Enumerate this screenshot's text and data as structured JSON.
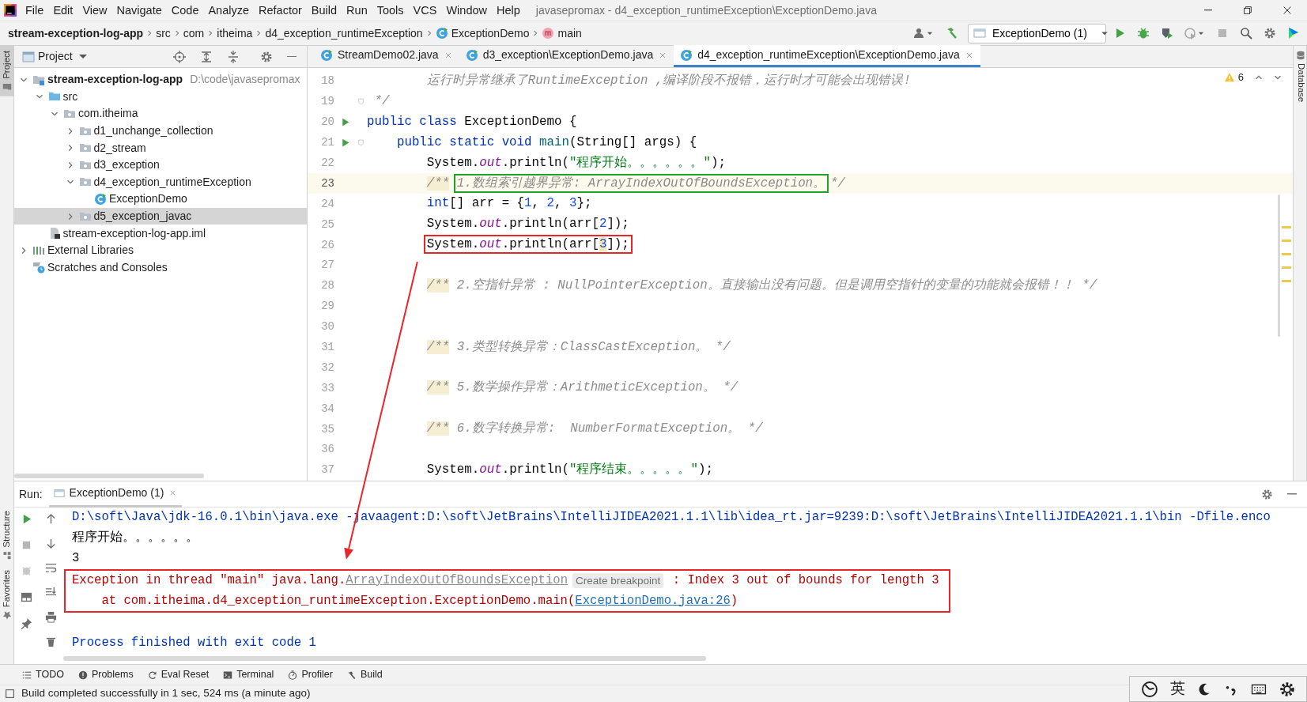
{
  "window": {
    "title": "javasepromax - d4_exception_runtimeException\\ExceptionDemo.java"
  },
  "menu": [
    "File",
    "Edit",
    "View",
    "Navigate",
    "Code",
    "Analyze",
    "Refactor",
    "Build",
    "Run",
    "Tools",
    "VCS",
    "Window",
    "Help"
  ],
  "breadcrumbs": [
    {
      "label": "stream-exception-log-app",
      "kind": "project"
    },
    {
      "label": "src",
      "kind": "dir"
    },
    {
      "label": "com",
      "kind": "dir"
    },
    {
      "label": "itheima",
      "kind": "dir"
    },
    {
      "label": "d4_exception_runtimeException",
      "kind": "dir"
    },
    {
      "label": "ExceptionDemo",
      "kind": "class"
    },
    {
      "label": "main",
      "kind": "method"
    }
  ],
  "run_config": {
    "label": "ExceptionDemo (1)"
  },
  "left_strip": {
    "top": [
      {
        "label": "Project",
        "selected": true
      }
    ],
    "bottom": [
      {
        "label": "Structure",
        "selected": false
      },
      {
        "label": "Favorites",
        "selected": false
      }
    ]
  },
  "right_strip": [
    {
      "label": "Database"
    }
  ],
  "project_panel": {
    "title": "Project",
    "tree": [
      {
        "label": "stream-exception-log-app",
        "path": "D:\\code\\javasepromax",
        "kind": "module",
        "expanded": true,
        "selected": false,
        "children": [
          {
            "label": "src",
            "kind": "src",
            "expanded": true,
            "selected": false,
            "children": [
              {
                "label": "com.itheima",
                "kind": "package",
                "expanded": true,
                "selected": false,
                "children": [
                  {
                    "label": "d1_unchange_collection",
                    "kind": "package",
                    "expanded": false,
                    "selected": false
                  },
                  {
                    "label": "d2_stream",
                    "kind": "package",
                    "expanded": false,
                    "selected": false
                  },
                  {
                    "label": "d3_exception",
                    "kind": "package",
                    "expanded": false,
                    "selected": false
                  },
                  {
                    "label": "d4_exception_runtimeException",
                    "kind": "package",
                    "expanded": true,
                    "selected": false,
                    "children": [
                      {
                        "label": "ExceptionDemo",
                        "kind": "class",
                        "selected": false
                      }
                    ]
                  },
                  {
                    "label": "d5_exception_javac",
                    "kind": "package",
                    "expanded": false,
                    "selected": true
                  }
                ]
              }
            ]
          },
          {
            "label": "stream-exception-log-app.iml",
            "kind": "iml",
            "selected": false
          }
        ]
      },
      {
        "label": "External Libraries",
        "kind": "library",
        "expanded": false,
        "selected": false
      },
      {
        "label": "Scratches and Consoles",
        "kind": "scratch",
        "selected": false
      }
    ]
  },
  "editor": {
    "tabs": [
      {
        "label": "StreamDemo02.java",
        "selected": false
      },
      {
        "label": "d3_exception\\ExceptionDemo.java",
        "selected": false
      },
      {
        "label": "d4_exception_runtimeException\\ExceptionDemo.java",
        "selected": true
      }
    ],
    "warnings": "6",
    "lines": [
      {
        "n": "18",
        "segs": [
          {
            "kind": "comment",
            "t": "        运行时异常继承了RuntimeException ,编译阶段不报错，运行时才可能会出现错误!"
          }
        ]
      },
      {
        "n": "19",
        "fold": true,
        "segs": [
          {
            "kind": "comment",
            "t": " */"
          }
        ]
      },
      {
        "n": "20",
        "run": true,
        "segs": [
          {
            "kind": "kw",
            "t": "public class "
          },
          {
            "kind": "plain",
            "t": "ExceptionDemo {"
          }
        ]
      },
      {
        "n": "21",
        "run": true,
        "fold": true,
        "segs": [
          {
            "kind": "kw",
            "t": "    public static void "
          },
          {
            "kind": "decl",
            "t": "main"
          },
          {
            "kind": "plain",
            "t": "(String[] args) {"
          }
        ]
      },
      {
        "n": "22",
        "segs": [
          {
            "kind": "plain",
            "t": "        System."
          },
          {
            "kind": "field",
            "t": "out"
          },
          {
            "kind": "plain",
            "t": ".println("
          },
          {
            "kind": "str",
            "t": "\"程序开始。。。。。。\""
          },
          {
            "kind": "plain",
            "t": ");"
          }
        ]
      },
      {
        "n": "23",
        "current": true,
        "segs": [
          {
            "kind": "doc",
            "t": "        /**"
          },
          {
            "kind": "box",
            "color": "#1fa22e",
            "segs": [
              {
                "kind": "comment",
                "t": " 1.数组索引越界异常: ArrayIndexOutOfBoundsException。"
              }
            ]
          },
          {
            "kind": "comment",
            "t": "*/"
          }
        ]
      },
      {
        "n": "24",
        "segs": [
          {
            "kind": "kw",
            "t": "        int"
          },
          {
            "kind": "plain",
            "t": "[] arr = {"
          },
          {
            "kind": "num",
            "t": "1"
          },
          {
            "kind": "plain",
            "t": ", "
          },
          {
            "kind": "num",
            "t": "2"
          },
          {
            "kind": "plain",
            "t": ", "
          },
          {
            "kind": "num",
            "t": "3"
          },
          {
            "kind": "plain",
            "t": "};"
          }
        ]
      },
      {
        "n": "25",
        "segs": [
          {
            "kind": "plain",
            "t": "        System."
          },
          {
            "kind": "field",
            "t": "out"
          },
          {
            "kind": "plain",
            "t": ".println(arr["
          },
          {
            "kind": "num",
            "t": "2"
          },
          {
            "kind": "plain",
            "t": "]);"
          }
        ]
      },
      {
        "n": "26",
        "segs": [
          {
            "kind": "box",
            "color": "#e8262a",
            "segs": [
              {
                "kind": "plain",
                "t": "        System."
              },
              {
                "kind": "field",
                "t": "out"
              },
              {
                "kind": "plain",
                "t": ".println(arr["
              },
              {
                "kind": "numcaret",
                "t": "3"
              },
              {
                "kind": "plain",
                "t": "]);"
              }
            ]
          }
        ]
      },
      {
        "n": "27"
      },
      {
        "n": "28",
        "segs": [
          {
            "kind": "doc",
            "t": "        /**"
          },
          {
            "kind": "comment",
            "t": " 2.空指针异常 : NullPointerException。直接输出没有问题。但是调用空指针的变量的功能就会报错！！ */"
          }
        ]
      },
      {
        "n": "29"
      },
      {
        "n": "30"
      },
      {
        "n": "31",
        "segs": [
          {
            "kind": "doc",
            "t": "        /**"
          },
          {
            "kind": "comment",
            "t": " 3.类型转换异常：ClassCastException。 */"
          }
        ]
      },
      {
        "n": "32"
      },
      {
        "n": "33",
        "segs": [
          {
            "kind": "doc",
            "t": "        /**"
          },
          {
            "kind": "comment",
            "t": " 5.数学操作异常：ArithmeticException。 */"
          }
        ]
      },
      {
        "n": "34"
      },
      {
        "n": "35",
        "segs": [
          {
            "kind": "doc",
            "t": "        /**"
          },
          {
            "kind": "comment",
            "t": " 6.数字转换异常:  NumberFormatException。 */"
          }
        ]
      },
      {
        "n": "36"
      },
      {
        "n": "37",
        "segs": [
          {
            "kind": "plain",
            "t": "        System."
          },
          {
            "kind": "field",
            "t": "out"
          },
          {
            "kind": "plain",
            "t": ".println("
          },
          {
            "kind": "str",
            "t": "\"程序结束。。。。。\""
          },
          {
            "kind": "plain",
            "t": ");"
          }
        ]
      }
    ]
  },
  "run_panel": {
    "label": "Run:",
    "tabs": [
      {
        "label": "ExceptionDemo (1)",
        "selected": true
      }
    ],
    "console": [
      {
        "kind": "cmd",
        "text": "D:\\soft\\Java\\jdk-16.0.1\\bin\\java.exe -javaagent:D:\\soft\\JetBrains\\IntelliJIDEA2021.1.1\\lib\\idea_rt.jar=9239:D:\\soft\\JetBrains\\IntelliJIDEA2021.1.1\\bin -Dfile.enco"
      },
      {
        "kind": "out",
        "text": "程序开始。。。。。。"
      },
      {
        "kind": "out",
        "text": "3"
      },
      {
        "kind": "box",
        "color": "#e8262a",
        "lines": [
          [
            {
              "kind": "err",
              "t": "Exception in thread \"main\" java.lang."
            },
            {
              "kind": "errlink",
              "t": "ArrayIndexOutOfBoundsException"
            },
            {
              "kind": "inlay",
              "t": "Create breakpoint"
            },
            {
              "kind": "err",
              "t": " : Index 3 out of bounds for length 3"
            }
          ],
          [
            {
              "kind": "err",
              "t": "    at com.itheima.d4_exception_runtimeException.ExceptionDemo.main("
            },
            {
              "kind": "link",
              "t": "ExceptionDemo.java:26"
            },
            {
              "kind": "err",
              "t": ")"
            }
          ]
        ]
      },
      {
        "kind": "blank"
      },
      {
        "kind": "exit",
        "text": "Process finished with exit code 1"
      }
    ]
  },
  "annotation_arrow": {
    "color": "#e8262a"
  },
  "tool_tabs": [
    "TODO",
    "Problems",
    "Eval Reset",
    "Terminal",
    "Profiler",
    "Build"
  ],
  "status_bar": {
    "text": "Build completed successfully in 1 sec, 524 ms (a minute ago)"
  },
  "ime_bar": {
    "label": "英"
  }
}
